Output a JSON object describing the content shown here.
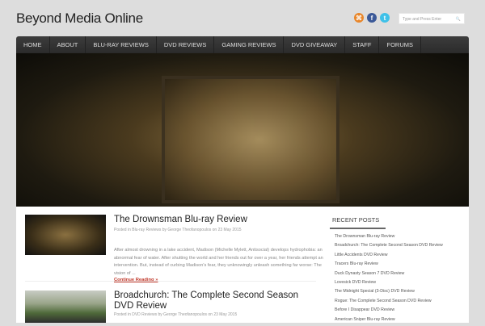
{
  "site": {
    "title": "Beyond Media Online"
  },
  "social": [
    {
      "name": "rss",
      "glyph": "⌘",
      "color": "#e8862a"
    },
    {
      "name": "facebook",
      "glyph": "f",
      "color": "#3b5998"
    },
    {
      "name": "twitter",
      "glyph": "t",
      "color": "#3fc1e8"
    }
  ],
  "search": {
    "placeholder": "Type and Press Enter",
    "icon": "🔍"
  },
  "nav": [
    "HOME",
    "ABOUT",
    "BLU-RAY REVIEWS",
    "DVD REVIEWS",
    "GAMING REVIEWS",
    "DVD GIVEAWAY",
    "STAFF",
    "FORUMS"
  ],
  "posts": [
    {
      "title": "The Drownsman Blu-ray Review",
      "meta": "Posted in Blu-ray Reviews by George Theofanopoulos on 23 May 2015",
      "excerpt": "After almost drowning in a lake accident, Madison (Michelle Mylett, Antisocial) develops hydrophobia: an abnormal fear of water. After shutting the world and her friends out for over a year, her friends attempt an intervention. But, instead of curbing Madison's fear, they unknowingly unleash something far worse: The vision of ...",
      "more": "Continue Reading »"
    },
    {
      "title": "Broadchurch: The Complete Second Season DVD Review",
      "meta": "Posted in DVD Reviews by George Theofanopoulos on 23 May 2015"
    }
  ],
  "sidebar": {
    "title": "RECENT POSTS",
    "items": [
      "The Drownsman Blu-ray Review",
      "Broadchurch: The Complete Second Season DVD Review",
      "Little Accidents DVD Review",
      "Tracers Blu-ray Review",
      "Duck Dynasty Season 7 DVD Review",
      "Lovesick DVD Review",
      "The Midnight Special (3-Disc) DVD Review",
      "Rogue: The Complete Second Season DVD Review",
      "Before I Disappear DVD Review",
      "American Sniper Blu-ray Review"
    ]
  }
}
